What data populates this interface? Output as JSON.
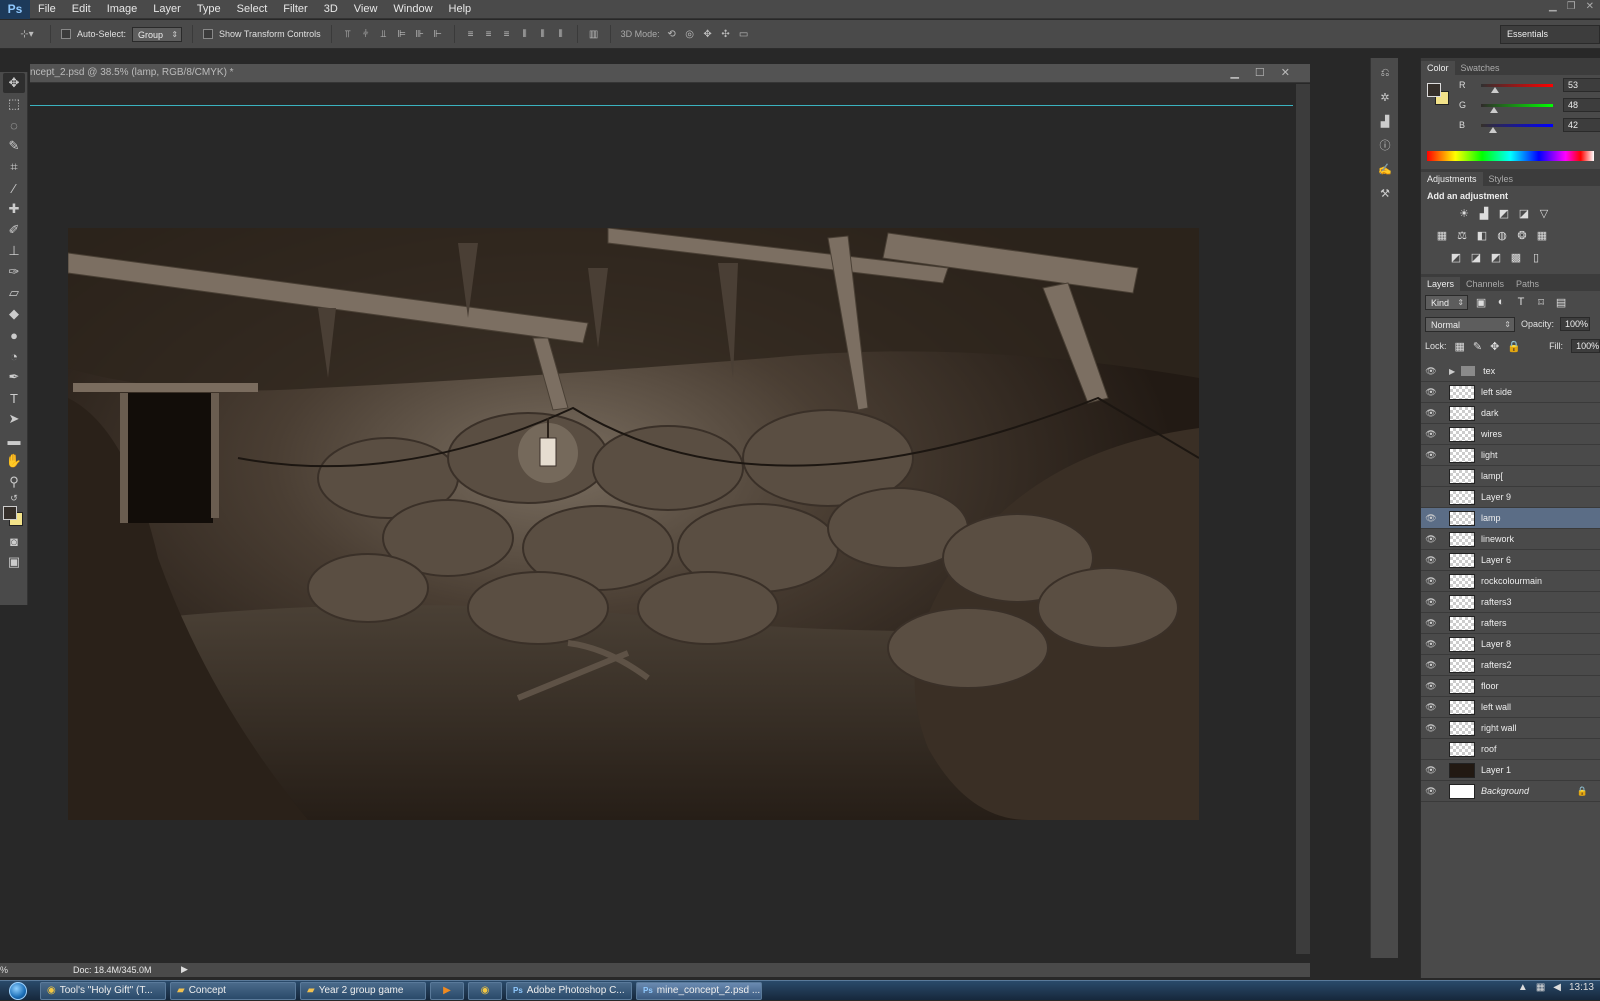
{
  "app": {
    "logo": "Ps"
  },
  "menu": [
    "File",
    "Edit",
    "Image",
    "Layer",
    "Type",
    "Select",
    "Filter",
    "3D",
    "View",
    "Window",
    "Help"
  ],
  "options": {
    "auto_select_label": "Auto-Select:",
    "auto_select_value": "Group",
    "transform_label": "Show Transform Controls",
    "mode_label": "3D Mode:",
    "workspace": "Essentials"
  },
  "document": {
    "title": "ncept_2.psd @ 38.5% (lamp, RGB/8/CMYK) *",
    "zoom": "%",
    "doc_info": "Doc: 18.4M/345.0M"
  },
  "color_panel": {
    "tabs": [
      "Color",
      "Swatches"
    ],
    "fg_color": "#352f2a",
    "bg_color": "#f3e38a",
    "r": {
      "label": "R",
      "value": "53"
    },
    "g": {
      "label": "G",
      "value": "48"
    },
    "b": {
      "label": "B",
      "value": "42"
    }
  },
  "adjustments": {
    "tabs": [
      "Adjustments",
      "Styles"
    ],
    "title": "Add an adjustment"
  },
  "layers_panel": {
    "tabs": [
      "Layers",
      "Channels",
      "Paths"
    ],
    "kind_label": "Kind",
    "blend_mode": "Normal",
    "opacity_label": "Opacity:",
    "opacity": "100%",
    "lock_label": "Lock:",
    "fill_label": "Fill:",
    "fill": "100%",
    "layers": [
      {
        "name": "tex",
        "visible": true,
        "type": "group"
      },
      {
        "name": "left side",
        "visible": true
      },
      {
        "name": "dark",
        "visible": true
      },
      {
        "name": "wires",
        "visible": true
      },
      {
        "name": "light",
        "visible": true
      },
      {
        "name": "lamp[",
        "visible": false
      },
      {
        "name": "Layer 9",
        "visible": false
      },
      {
        "name": "lamp",
        "visible": true,
        "selected": true
      },
      {
        "name": "linework",
        "visible": true
      },
      {
        "name": "Layer 6",
        "visible": true
      },
      {
        "name": "rockcolourmain",
        "visible": true
      },
      {
        "name": "rafters3",
        "visible": true
      },
      {
        "name": "rafters",
        "visible": true
      },
      {
        "name": "Layer 8",
        "visible": true
      },
      {
        "name": "rafters2",
        "visible": true
      },
      {
        "name": "floor",
        "visible": true
      },
      {
        "name": "left wall",
        "visible": true
      },
      {
        "name": "right wall",
        "visible": true
      },
      {
        "name": "roof",
        "visible": false
      },
      {
        "name": "Layer 1",
        "visible": true
      },
      {
        "name": "Background",
        "visible": true,
        "locked": true
      }
    ]
  },
  "taskbar": {
    "items": [
      {
        "label": "Tool's \"Holy Gift\" (T...",
        "icon": "chrome-icon"
      },
      {
        "label": "Concept",
        "icon": "folder-icon"
      },
      {
        "label": "Year 2 group game",
        "icon": "folder-icon"
      },
      {
        "label": "",
        "icon": "media-icon"
      },
      {
        "label": "",
        "icon": "chrome-icon"
      },
      {
        "label": "Adobe Photoshop C...",
        "icon": "ps-icon"
      },
      {
        "label": "mine_concept_2.psd ...",
        "icon": "ps-icon"
      }
    ],
    "time": "13:13"
  }
}
